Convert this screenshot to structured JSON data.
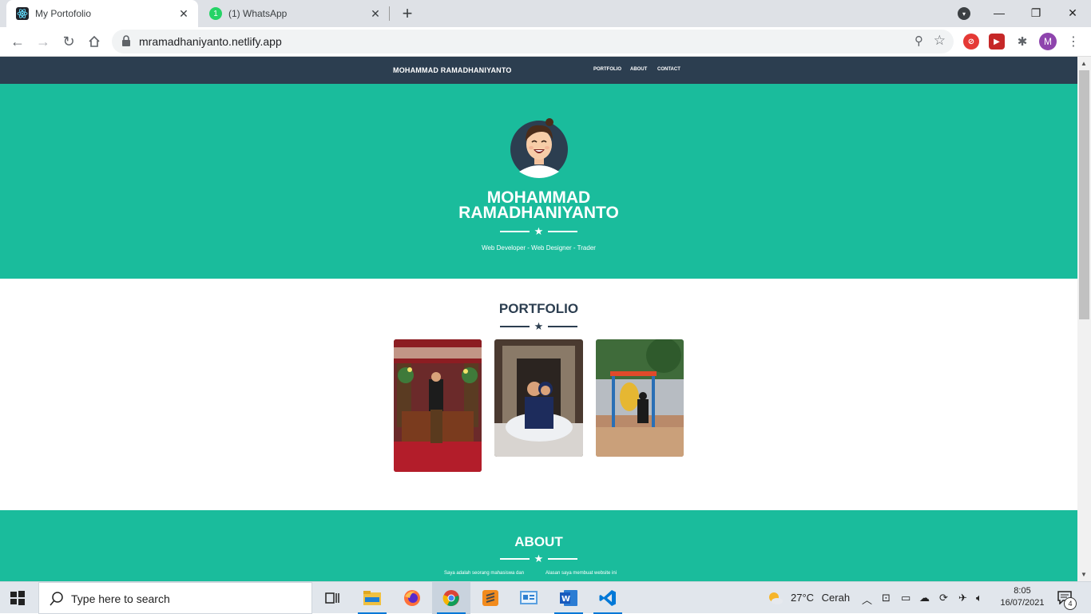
{
  "browser": {
    "tabs": [
      {
        "title": "My Portofolio",
        "favicon": "react-icon",
        "active": true
      },
      {
        "title": "(1) WhatsApp",
        "favicon": "whatsapp-icon",
        "badge": "1",
        "active": false
      }
    ],
    "url": "mramadhaniyanto.netlify.app",
    "profile_initial": "M"
  },
  "site": {
    "brand": "MOHAMMAD RAMADHANIYANTO",
    "nav": [
      "PORTFOLIO",
      "ABOUT",
      "CONTACT"
    ],
    "hero": {
      "name_line1": "MOHAMMAD",
      "name_line2": "RAMADHANIYANTO",
      "subtitle": "Web Developer - Web Designer - Trader"
    },
    "portfolio": {
      "title": "PORTFOLIO",
      "items": [
        "photo-wedding-red-carpet",
        "photo-couple-sofa",
        "photo-playground"
      ]
    },
    "about": {
      "title": "ABOUT",
      "left_text": "Saya adalah seorang mahasiswa dan",
      "right_text": "Alasan saya membuat website ini"
    },
    "colors": {
      "primary": "#2c3e50",
      "accent": "#1abc9c"
    }
  },
  "taskbar": {
    "search_placeholder": "Type here to search",
    "weather_temp": "27°C",
    "weather_desc": "Cerah",
    "time": "8:05",
    "date": "16/07/2021",
    "notification_count": "4"
  }
}
